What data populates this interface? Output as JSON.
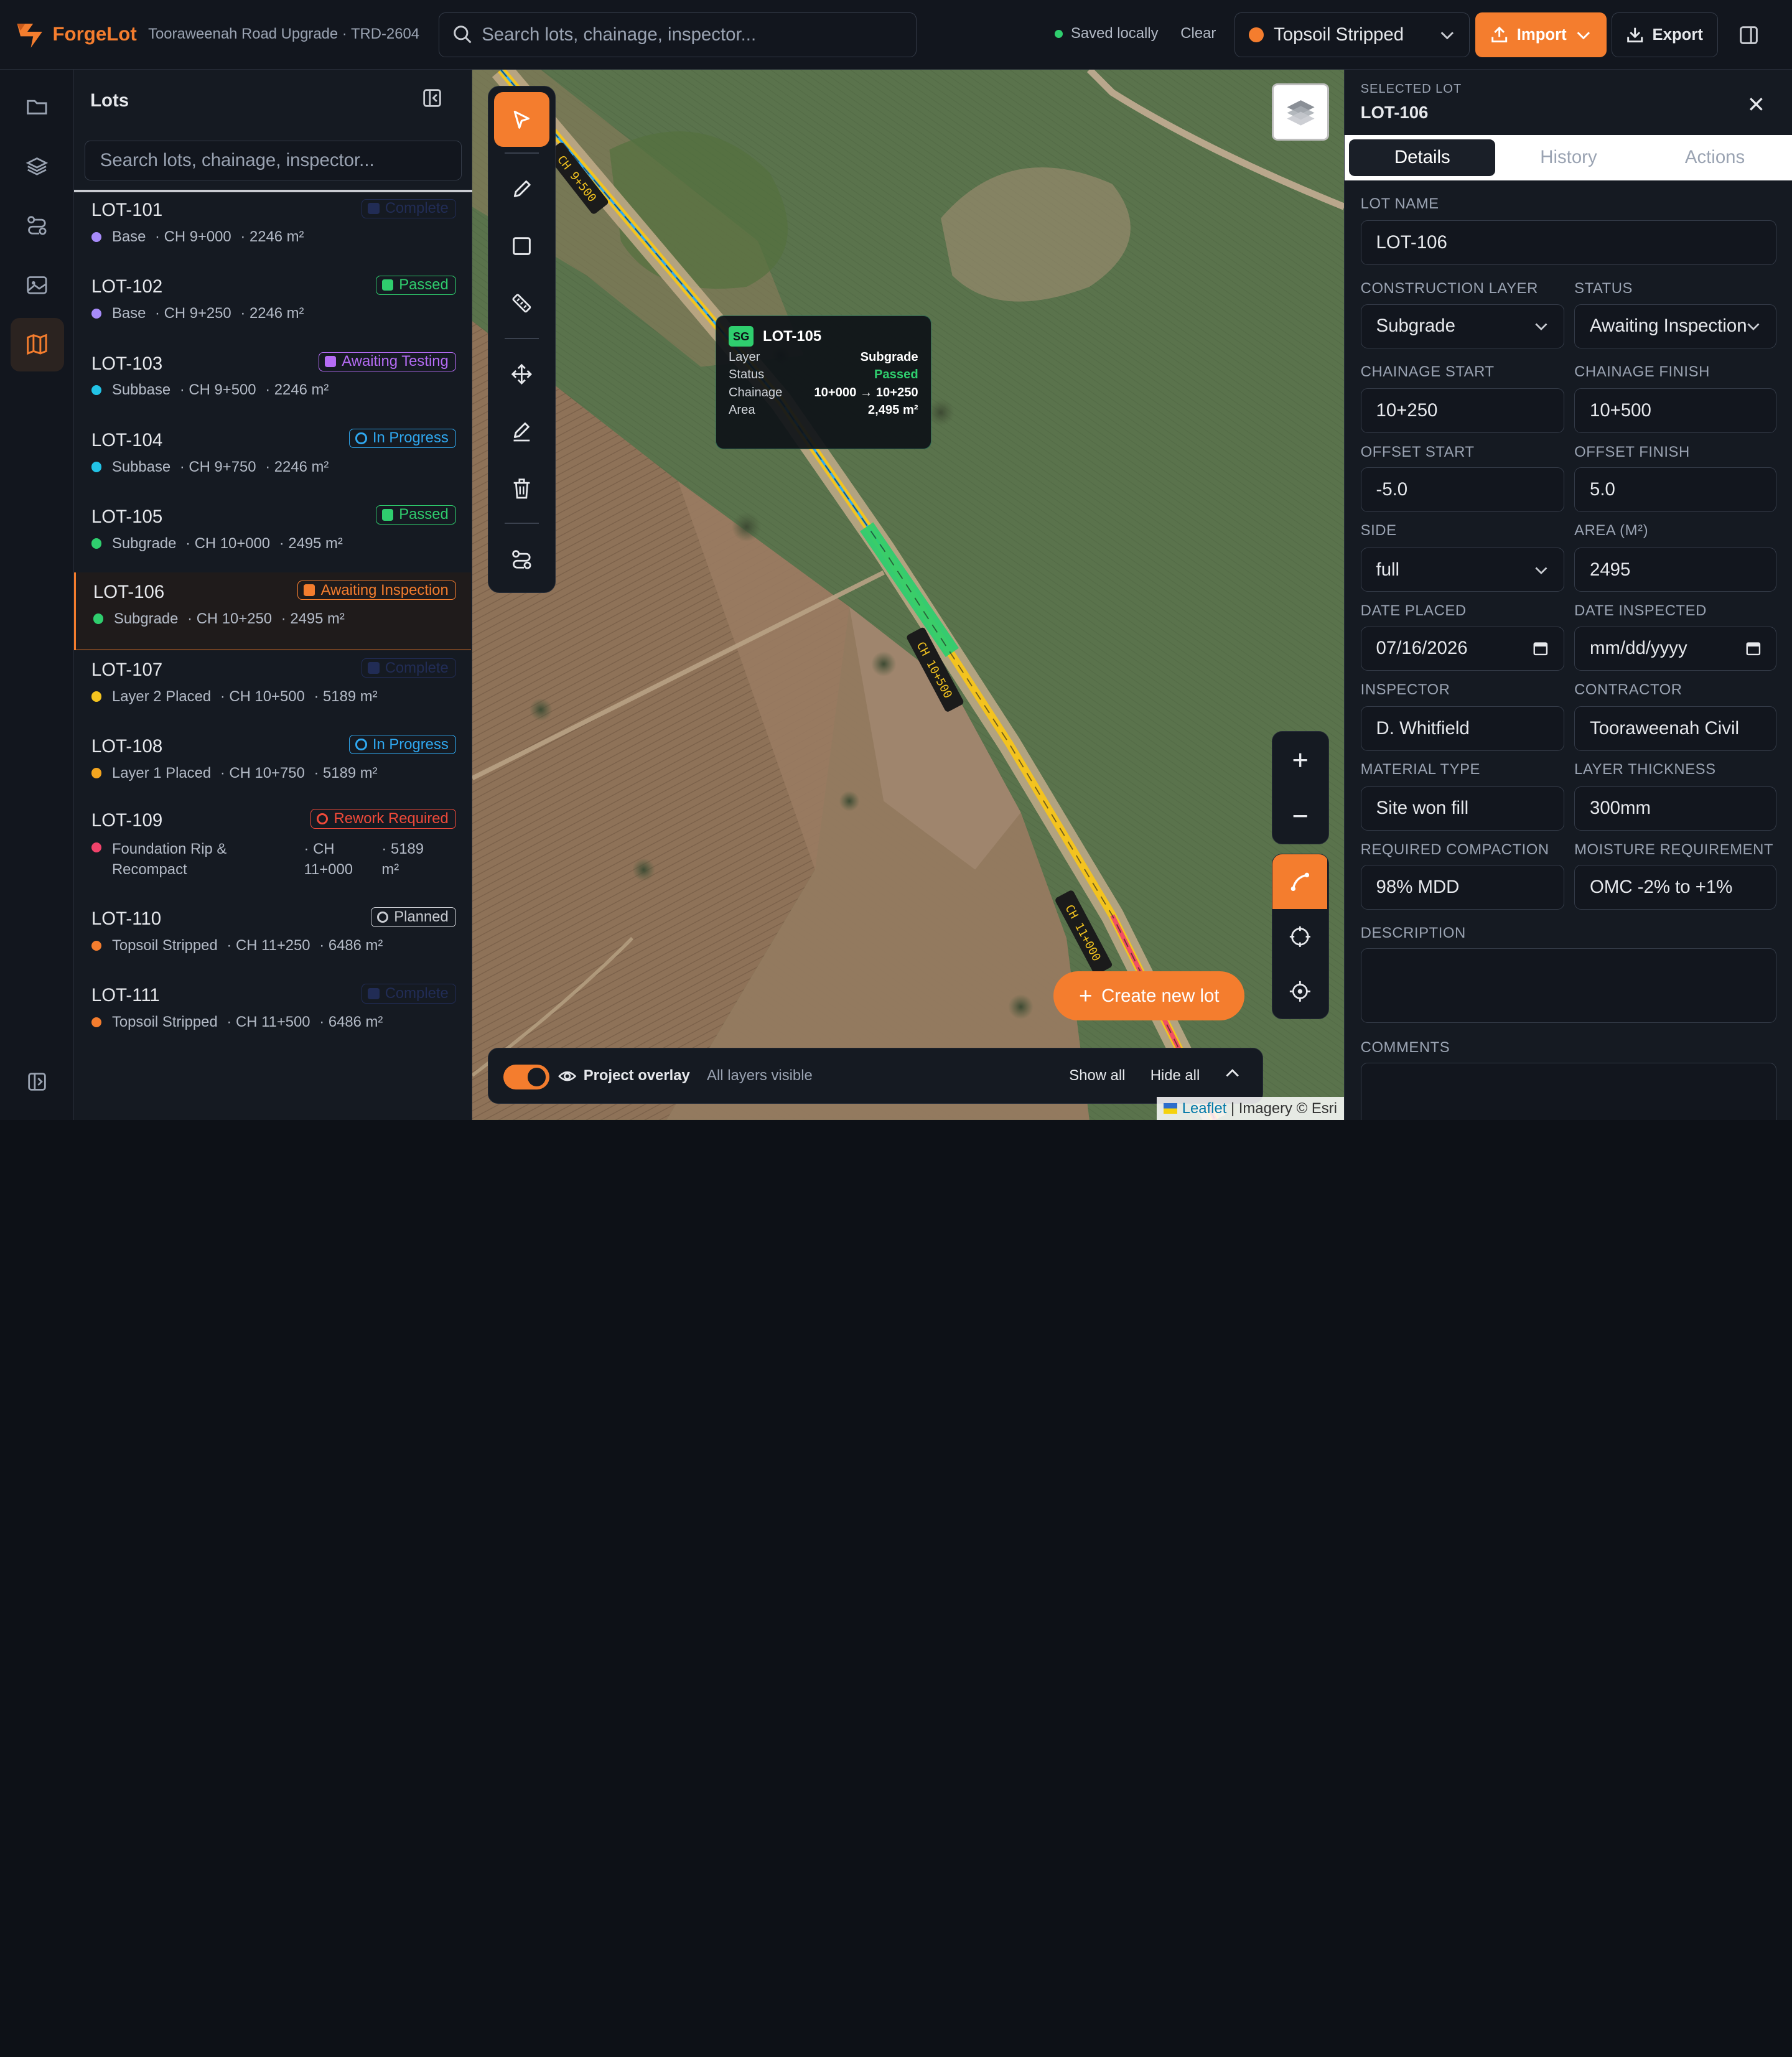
{
  "app": {
    "name": "ForgeLot",
    "project": "Tooraweenah Road Upgrade · TRD-2604",
    "search_placeholder": "Search lots, chainage, inspector...",
    "saved_status": "Saved locally",
    "clear_label": "Clear",
    "active_layer": "Topsoil Stripped",
    "import_label": "Import",
    "export_label": "Export",
    "accent_color": "#f47d2e"
  },
  "rail": {
    "items": [
      {
        "icon": "folder-icon"
      },
      {
        "icon": "layers-icon"
      },
      {
        "icon": "route-icon"
      },
      {
        "icon": "image-icon"
      },
      {
        "icon": "map-icon",
        "active": true
      }
    ]
  },
  "lots_panel": {
    "title": "Lots",
    "search_placeholder": "Search lots, chainage, inspector...",
    "lots": [
      {
        "id": "LOT-101",
        "layer": "Base",
        "chainage": "· CH 9+000",
        "area": "· 2246 m²",
        "status": "Complete",
        "layer_color": "#a78bfa",
        "badge_color": "#24305e",
        "badge_style": "square"
      },
      {
        "id": "LOT-102",
        "layer": "Base",
        "chainage": "· CH 9+250",
        "area": "· 2246 m²",
        "status": "Passed",
        "layer_color": "#a78bfa",
        "badge_color": "#2fce6e",
        "badge_style": "square"
      },
      {
        "id": "LOT-103",
        "layer": "Subbase",
        "chainage": "· CH 9+500",
        "area": "· 2246 m²",
        "status": "Awaiting Testing",
        "layer_color": "#22c3e6",
        "badge_color": "#b56cf5",
        "badge_style": "square"
      },
      {
        "id": "LOT-104",
        "layer": "Subbase",
        "chainage": "· CH 9+750",
        "area": "· 2246 m²",
        "status": "In Progress",
        "layer_color": "#22c3e6",
        "badge_color": "#2fa8f0",
        "badge_style": "ring"
      },
      {
        "id": "LOT-105",
        "layer": "Subgrade",
        "chainage": "· CH 10+000",
        "area": "· 2495 m²",
        "status": "Passed",
        "layer_color": "#2fce6e",
        "badge_color": "#2fce6e",
        "badge_style": "square"
      },
      {
        "id": "LOT-106",
        "layer": "Subgrade",
        "chainage": "· CH 10+250",
        "area": "· 2495 m²",
        "status": "Awaiting Inspection",
        "layer_color": "#2fce6e",
        "badge_color": "#f47d2e",
        "badge_style": "square",
        "selected": true
      },
      {
        "id": "LOT-107",
        "layer": "Layer 2 Placed",
        "chainage": "· CH 10+500",
        "area": "· 5189 m²",
        "status": "Complete",
        "layer_color": "#f3c31f",
        "badge_color": "#24305e",
        "badge_style": "square"
      },
      {
        "id": "LOT-108",
        "layer": "Layer 1 Placed",
        "chainage": "· CH 10+750",
        "area": "· 5189 m²",
        "status": "In Progress",
        "layer_color": "#f3a51f",
        "badge_color": "#2fa8f0",
        "badge_style": "ring"
      },
      {
        "id": "LOT-109",
        "layer": "Foundation Rip & Recompact",
        "chainage": "· CH 11+000",
        "area": "· 5189 m²",
        "status": "Rework Required",
        "layer_color": "#f0436b",
        "badge_color": "#f04a3a",
        "badge_style": "ring",
        "tall": true
      },
      {
        "id": "LOT-110",
        "layer": "Topsoil Stripped",
        "chainage": "· CH 11+250",
        "area": "· 6486 m²",
        "status": "Planned",
        "layer_color": "#f47d2e",
        "badge_color": "#c9ccd2",
        "badge_style": "ring"
      },
      {
        "id": "LOT-111",
        "layer": "Topsoil Stripped",
        "chainage": "· CH 11+500",
        "area": "· 6486 m²",
        "status": "Complete",
        "layer_color": "#f47d2e",
        "badge_color": "#24305e",
        "badge_style": "square"
      }
    ]
  },
  "map": {
    "chainage_labels": [
      "CH 9+500",
      "CH 10+500",
      "CH 11+000"
    ],
    "tooltip": {
      "code": "SG",
      "title": "LOT-105",
      "rows": [
        {
          "label": "Layer",
          "value": "Subgrade"
        },
        {
          "label": "Status",
          "value": "Passed"
        },
        {
          "label": "Chainage",
          "value": "10+000 → 10+250"
        },
        {
          "label": "Area",
          "value": "2,495 m²"
        }
      ]
    },
    "create_label": "Create new lot",
    "overlay": {
      "label": "Project overlay",
      "sub": "All layers visible",
      "show_all": "Show all",
      "hide_all": "Hide all",
      "enabled": true
    },
    "attribution_leaflet": "Leaflet",
    "attribution_rest": " | Imagery © Esri"
  },
  "detail": {
    "caption": "SELECTED LOT",
    "title": "LOT-106",
    "tabs": [
      "Details",
      "History",
      "Actions"
    ],
    "active_tab": "Details",
    "fields": {
      "lot_name": {
        "label": "LOT NAME",
        "value": "LOT-106"
      },
      "construction_layer": {
        "label": "CONSTRUCTION LAYER",
        "value": "Subgrade"
      },
      "status": {
        "label": "STATUS",
        "value": "Awaiting Inspection"
      },
      "chainage_start": {
        "label": "CHAINAGE START",
        "value": "10+250"
      },
      "chainage_finish": {
        "label": "CHAINAGE FINISH",
        "value": "10+500"
      },
      "offset_start": {
        "label": "OFFSET START",
        "value": "-5.0"
      },
      "offset_finish": {
        "label": "OFFSET FINISH",
        "value": "5.0"
      },
      "side": {
        "label": "SIDE",
        "value": "full"
      },
      "area": {
        "label": "AREA (M²)",
        "value": "2495"
      },
      "date_placed": {
        "label": "DATE PLACED",
        "value": "07/16/2026"
      },
      "date_inspected": {
        "label": "DATE INSPECTED",
        "value": "mm/dd/yyyy"
      },
      "inspector": {
        "label": "INSPECTOR",
        "value": "D. Whitfield"
      },
      "contractor": {
        "label": "CONTRACTOR",
        "value": "Tooraweenah Civil"
      },
      "material_type": {
        "label": "MATERIAL TYPE",
        "value": "Site won fill"
      },
      "layer_thickness": {
        "label": "LAYER THICKNESS",
        "value": "300mm"
      },
      "required_compaction": {
        "label": "REQUIRED COMPACTION",
        "value": "98% MDD"
      },
      "moisture_requirement": {
        "label": "MOISTURE REQUIREMENT",
        "value": "OMC -2% to +1%"
      },
      "description": {
        "label": "DESCRIPTION",
        "value": ""
      },
      "comments": {
        "label": "COMMENTS",
        "value": ""
      }
    }
  }
}
